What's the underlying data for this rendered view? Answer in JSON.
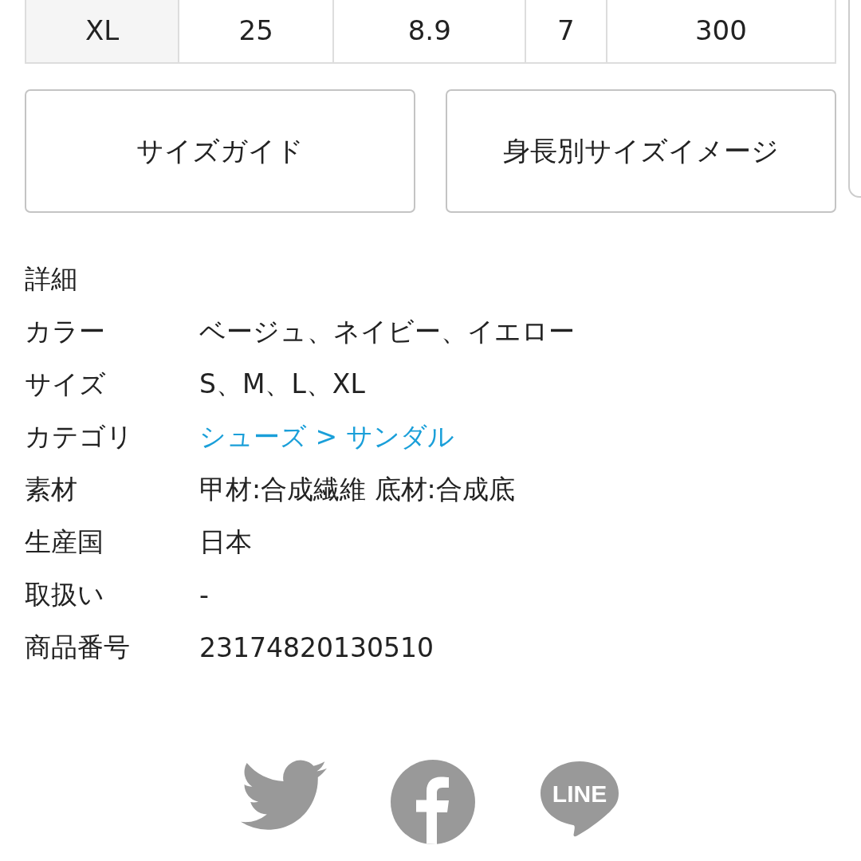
{
  "size_table": {
    "rows": [
      [
        "XL",
        "25",
        "8.9",
        "7",
        "300"
      ]
    ]
  },
  "buttons": [
    {
      "label": "サイズガイド"
    },
    {
      "label": "身長別サイズイメージ"
    }
  ],
  "details": {
    "heading": "詳細",
    "rows": [
      {
        "label": "カラー",
        "value": "ベージュ、ネイビー、イエロー",
        "kind": "text"
      },
      {
        "label": "サイズ",
        "value": "S、M、L、XL",
        "kind": "text"
      },
      {
        "label": "カテゴリ",
        "value": "シューズ > サンダル",
        "kind": "link"
      },
      {
        "label": "素材",
        "value": "甲材:合成繊維 底材:合成底",
        "kind": "text"
      },
      {
        "label": "生産国",
        "value": "日本",
        "kind": "text"
      },
      {
        "label": "取扱い",
        "value": "-",
        "kind": "text"
      },
      {
        "label": "商品番号",
        "value": "23174820130510",
        "kind": "text"
      }
    ]
  },
  "share": [
    {
      "kind": "twitter"
    },
    {
      "kind": "facebook"
    },
    {
      "kind": "line",
      "label": "LINE"
    }
  ]
}
